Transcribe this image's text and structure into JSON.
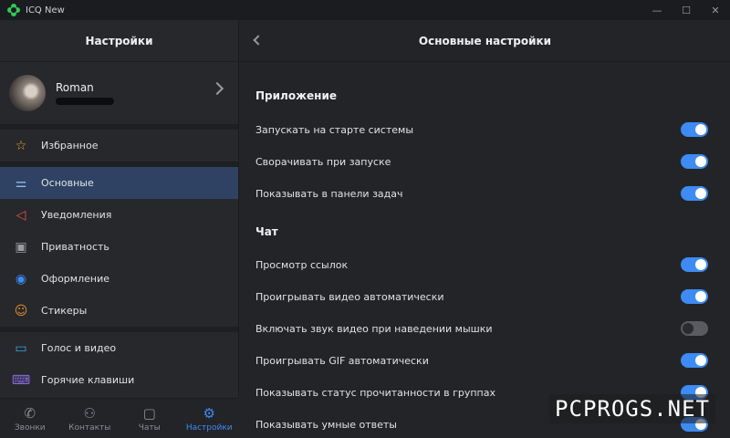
{
  "window": {
    "title": "ICQ New",
    "controls": [
      "—",
      "☐",
      "✕"
    ]
  },
  "sidebar": {
    "title": "Настройки",
    "profile": {
      "name": "Roman"
    },
    "favorites": {
      "label": "Избранное",
      "icon": "star-icon",
      "color": "#e5a530"
    },
    "items": [
      {
        "label": "Основные",
        "icon": "sliders-icon",
        "color": "#7ea6e0"
      },
      {
        "label": "Уведомления",
        "icon": "speaker-icon",
        "color": "#e5534b"
      },
      {
        "label": "Приватность",
        "icon": "lock-icon",
        "color": "#9a9aa0"
      },
      {
        "label": "Оформление",
        "icon": "palette-icon",
        "color": "#3d8bf3"
      },
      {
        "label": "Стикеры",
        "icon": "smile-icon",
        "color": "#e58b30"
      }
    ],
    "items2": [
      {
        "label": "Голос и видео",
        "icon": "video-icon",
        "color": "#3aa3e0"
      },
      {
        "label": "Горячие клавиши",
        "icon": "keyboard-icon",
        "color": "#8b6be0"
      }
    ]
  },
  "tabs": [
    {
      "label": "Звонки",
      "icon": "phone-icon"
    },
    {
      "label": "Контакты",
      "icon": "contacts-icon"
    },
    {
      "label": "Чаты",
      "icon": "chat-icon"
    },
    {
      "label": "Настройки",
      "icon": "gear-icon"
    }
  ],
  "main": {
    "title": "Основные настройки",
    "sections": [
      {
        "title": "Приложение",
        "rows": [
          {
            "label": "Запускать на старте системы",
            "on": true
          },
          {
            "label": "Сворачивать при запуске",
            "on": true
          },
          {
            "label": "Показывать в панели задач",
            "on": true
          }
        ]
      },
      {
        "title": "Чат",
        "rows": [
          {
            "label": "Просмотр ссылок",
            "on": true
          },
          {
            "label": "Проигрывать видео автоматически",
            "on": true
          },
          {
            "label": "Включать звук видео при наведении мышки",
            "on": false
          },
          {
            "label": "Проигрывать GIF автоматически",
            "on": true
          },
          {
            "label": "Показывать статус прочитанности в группах",
            "on": true
          },
          {
            "label": "Показывать умные ответы",
            "on": true
          }
        ]
      }
    ]
  },
  "watermark": "PCPROGS.NET"
}
